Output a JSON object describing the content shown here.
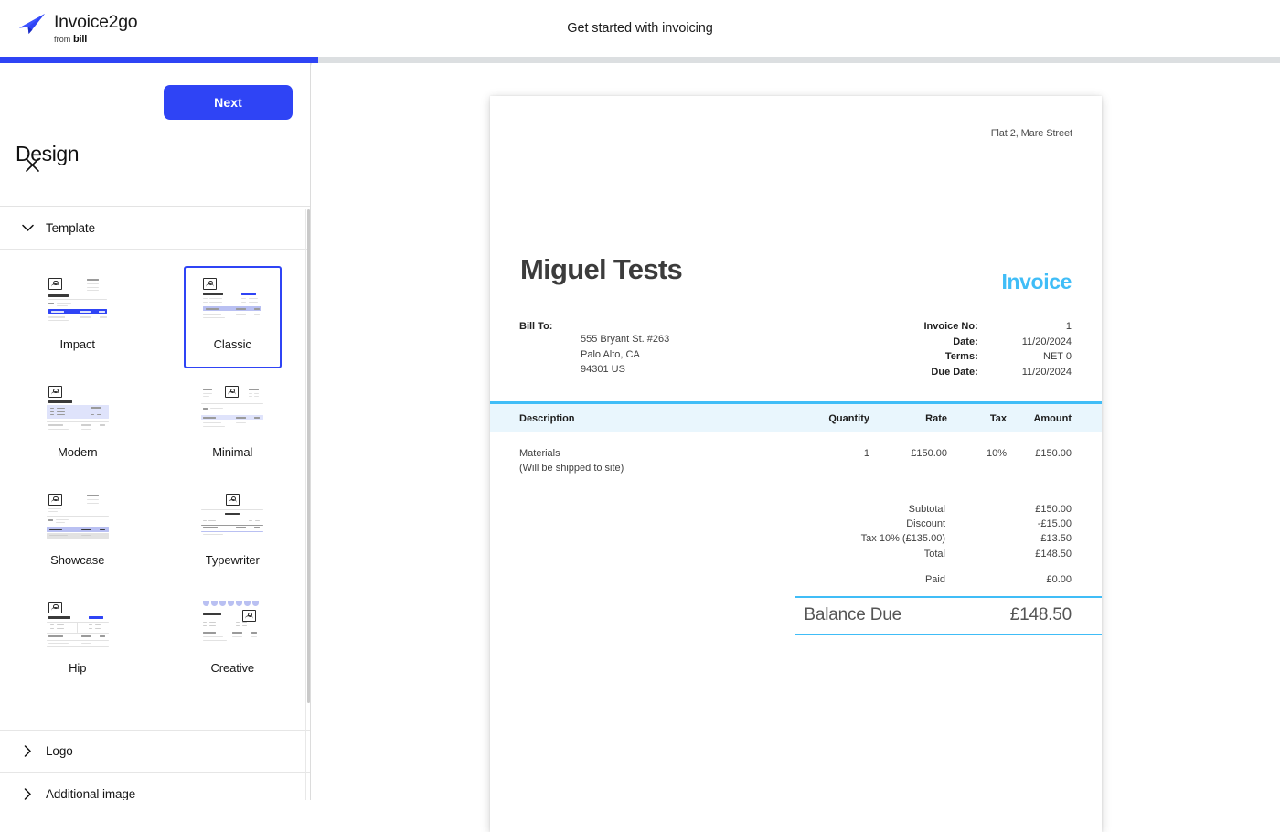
{
  "brand": {
    "name": "Invoice2go",
    "from_prefix": "from",
    "from_name": "bill",
    "primary": "#2f44f5",
    "accent": "#40bdf7"
  },
  "header": {
    "title": "Get started with invoicing",
    "progress_percent": 25
  },
  "sidebar": {
    "close_label": "×",
    "next_label": "Next",
    "page_title": "Design",
    "sections": [
      {
        "label": "Template",
        "expanded": true,
        "icon": "chevron-down-icon"
      },
      {
        "label": "Logo",
        "expanded": false,
        "icon": "chevron-right-icon"
      },
      {
        "label": "Additional image",
        "expanded": false,
        "icon": "chevron-right-icon"
      }
    ],
    "templates": [
      {
        "name": "Impact",
        "selected": false,
        "style": "impact"
      },
      {
        "name": "Classic",
        "selected": true,
        "style": "classic"
      },
      {
        "name": "Modern",
        "selected": false,
        "style": "modern"
      },
      {
        "name": "Minimal",
        "selected": false,
        "style": "minimal"
      },
      {
        "name": "Showcase",
        "selected": false,
        "style": "showcase"
      },
      {
        "name": "Typewriter",
        "selected": false,
        "style": "typewriter"
      },
      {
        "name": "Hip",
        "selected": false,
        "style": "hip"
      },
      {
        "name": "Creative",
        "selected": false,
        "style": "creative"
      }
    ]
  },
  "invoice": {
    "sender_address": "Flat 2, Mare Street",
    "company_name": "Miguel Tests",
    "doc_type": "Invoice",
    "bill_to_label": "Bill To:",
    "bill_to_lines": [
      "555 Bryant St. #263",
      "Palo Alto, CA",
      "94301 US"
    ],
    "meta": [
      {
        "key": "Invoice No:",
        "value": "1"
      },
      {
        "key": "Date:",
        "value": "11/20/2024"
      },
      {
        "key": "Terms:",
        "value": "NET 0"
      },
      {
        "key": "Due Date:",
        "value": "11/20/2024"
      }
    ],
    "columns": {
      "description": "Description",
      "quantity": "Quantity",
      "rate": "Rate",
      "tax": "Tax",
      "amount": "Amount"
    },
    "items": [
      {
        "description": "Materials",
        "description_note": "(Will be shipped to site)",
        "quantity": "1",
        "rate": "£150.00",
        "tax": "10%",
        "amount": "£150.00"
      }
    ],
    "totals": [
      {
        "key": "Subtotal",
        "value": "£150.00"
      },
      {
        "key": "Discount",
        "value": "-£15.00"
      },
      {
        "key": "Tax 10% (£135.00)",
        "value": "£13.50"
      },
      {
        "key": "Total",
        "value": "£148.50"
      }
    ],
    "paid": {
      "key": "Paid",
      "value": "£0.00"
    },
    "balance": {
      "key": "Balance Due",
      "value": "£148.50"
    }
  }
}
